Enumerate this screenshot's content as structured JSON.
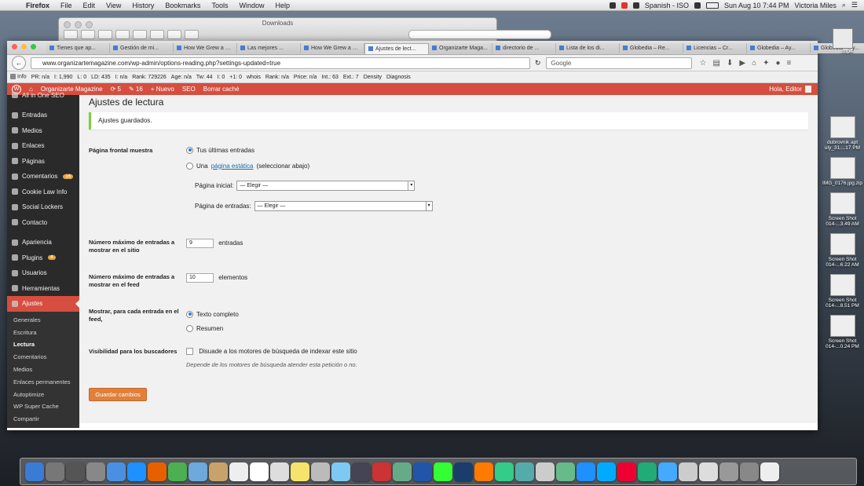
{
  "os_menubar": {
    "app": "Firefox",
    "menus": [
      "File",
      "Edit",
      "View",
      "History",
      "Bookmarks",
      "Tools",
      "Window",
      "Help"
    ],
    "language": "Spanish - ISO",
    "datetime": "Sun Aug 10  7:44 PM",
    "user": "Victoria Miles"
  },
  "finder": {
    "title": "Downloads"
  },
  "browser": {
    "tabs": [
      {
        "label": "Tienes que ap...",
        "active": false
      },
      {
        "label": "Gestión de mi...",
        "active": false
      },
      {
        "label": "How We Grew a Bl...",
        "active": false
      },
      {
        "label": "Las mejores ...",
        "active": false
      },
      {
        "label": "How We Grew a Bl...",
        "active": false
      },
      {
        "label": "Ajustes de lect...",
        "active": true
      },
      {
        "label": "Organizarte Maga...",
        "active": false
      },
      {
        "label": "directorio de ...",
        "active": false
      },
      {
        "label": "Lista de los di...",
        "active": false
      },
      {
        "label": "Globedia – Re...",
        "active": false
      },
      {
        "label": "Licencias – Cr...",
        "active": false
      },
      {
        "label": "Globedia – Ay...",
        "active": false
      },
      {
        "label": "Globedia – Ay...",
        "active": false
      }
    ],
    "url": "www.organizartemagazine.com/wp-admin/options-reading.php?settings-updated=true",
    "search_placeholder": "Google",
    "seobar": {
      "info": "Info",
      "pr": "PR: n/a",
      "links": "I: 1,990",
      "l": "L: 0",
      "ld": "LD: 435",
      "in": "I: n/a",
      "rank": "Rank: 729226",
      "age": "Age: n/a",
      "tw": "Tw: 44",
      "fb": "I: 0",
      "gplus": "+1: 0",
      "whois": "whois",
      "rank2": "Rank: n/a",
      "price": "Price: n/a",
      "int": "Int.: 63",
      "ext": "Ext.: 7",
      "density": "Density",
      "diagnosis": "Diagnosis"
    }
  },
  "wp_adminbar": {
    "site": "Organizarte Magazine",
    "updates": "5",
    "comments": "16",
    "new": "Nuevo",
    "seo": "SEO",
    "cache": "Borrar caché",
    "greeting": "Hola, Editor"
  },
  "sidebar": {
    "top_partial": "All in One SEO",
    "items": [
      {
        "label": "Entradas",
        "badge": ""
      },
      {
        "label": "Medios",
        "badge": ""
      },
      {
        "label": "Enlaces",
        "badge": ""
      },
      {
        "label": "Páginas",
        "badge": ""
      },
      {
        "label": "Comentarios",
        "badge": "16"
      },
      {
        "label": "Cookie Law Info",
        "badge": ""
      },
      {
        "label": "Social Lockers",
        "badge": ""
      },
      {
        "label": "Contacto",
        "badge": ""
      },
      {
        "label": "Apariencia",
        "badge": ""
      },
      {
        "label": "Plugins",
        "badge": "4"
      },
      {
        "label": "Usuarios",
        "badge": ""
      },
      {
        "label": "Herramientas",
        "badge": ""
      },
      {
        "label": "Ajustes",
        "badge": ""
      }
    ],
    "submenu": [
      "Generales",
      "Escritura",
      "Lectura",
      "Comentarios",
      "Medios",
      "Enlaces permanentes",
      "Autoptimize",
      "WP Super Cache",
      "Compartir"
    ]
  },
  "page": {
    "title": "Ajustes de lectura",
    "notice": "Ajustes guardados.",
    "front_label": "Página frontal muestra",
    "opt_latest": "Tus últimas entradas",
    "opt_static_pre": "Una",
    "opt_static_link": "página estática",
    "opt_static_post": "(seleccionar abajo)",
    "home_label": "Página inicial:",
    "home_value": "— Elegir —",
    "posts_label": "Página de entradas:",
    "posts_value": "— Elegir —",
    "blog_label": "Número máximo de entradas a mostrar en el sitio",
    "blog_value": "9",
    "blog_unit": "entradas",
    "feed_label": "Número máximo de entradas a mostrar en el feed",
    "feed_value": "10",
    "feed_unit": "elementos",
    "show_label": "Mostrar, para cada entrada en el feed,",
    "opt_full": "Texto completo",
    "opt_summary": "Resumen",
    "vis_label": "Visibilidad para los buscadores",
    "vis_checkbox": "Disuade a los motores de búsqueda de indexar este sitio",
    "vis_note": "Depende de los motores de búsqueda atender esta petición o no.",
    "save": "Guardar cambios"
  },
  "desktop": {
    "top_item": ".mp4",
    "items": [
      "dubrovnik apt uly_31....17 PM",
      "IMG_0176.jpg.zip",
      "Screen Shot 014-...3.49 AM",
      "Screen Shot 014-...6.22 AM",
      "Screen Shot 014-...8.51 PM",
      "Screen Shot 014-...0.24 PM"
    ]
  },
  "colors": {
    "wp_red": "#d54e3f",
    "sidebar": "#2a2a2a",
    "accent_button": "#e0803a",
    "notice_green": "#7ad03a"
  }
}
